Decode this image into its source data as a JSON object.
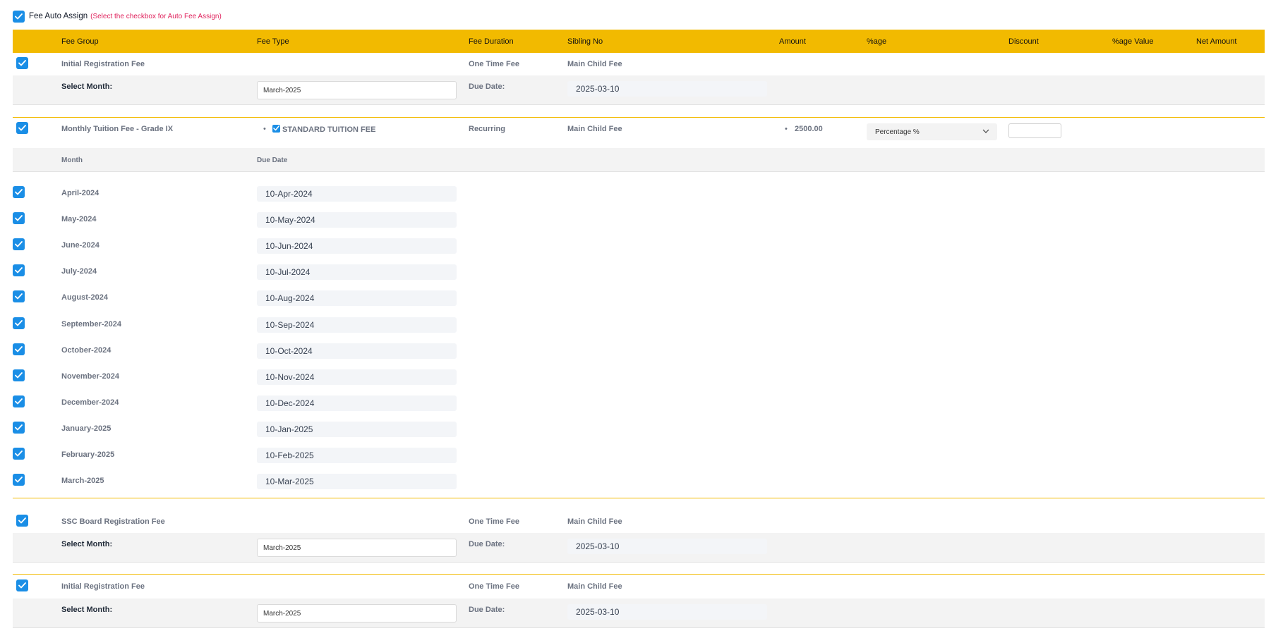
{
  "auto_assign": {
    "checked": true,
    "label": "Fee Auto Assign",
    "hint": "(Select the checkbox for Auto Fee Assign)"
  },
  "header": {
    "fee_group": "Fee Group",
    "fee_type": "Fee Type",
    "fee_duration": "Fee Duration",
    "sibling_no": "Sibling No",
    "amount": "Amount",
    "percentage": "%age",
    "discount": "Discount",
    "percentage_value": "%age Value",
    "net_amount": "Net Amount"
  },
  "common": {
    "select_month_label": "Select Month:",
    "due_date_label": "Due Date:",
    "month_col": "Month",
    "due_date_col": "Due Date"
  },
  "group1": {
    "name": "Initial Registration Fee",
    "duration": "One Time Fee",
    "sibling": "Main Child Fee",
    "month_value": "March-2025",
    "due_date_value": "2025-03-10"
  },
  "tuition": {
    "name": "Monthly Tuition Fee - Grade IX",
    "fee_type": "STANDARD TUITION FEE",
    "duration": "Recurring",
    "sibling": "Main Child Fee",
    "amount": "2500.00",
    "percentage_select": "Percentage %",
    "discount_value": "",
    "months": [
      {
        "month": "April-2024",
        "due": "10-Apr-2024"
      },
      {
        "month": "May-2024",
        "due": "10-May-2024"
      },
      {
        "month": "June-2024",
        "due": "10-Jun-2024"
      },
      {
        "month": "July-2024",
        "due": "10-Jul-2024"
      },
      {
        "month": "August-2024",
        "due": "10-Aug-2024"
      },
      {
        "month": "September-2024",
        "due": "10-Sep-2024"
      },
      {
        "month": "October-2024",
        "due": "10-Oct-2024"
      },
      {
        "month": "November-2024",
        "due": "10-Nov-2024"
      },
      {
        "month": "December-2024",
        "due": "10-Dec-2024"
      },
      {
        "month": "January-2025",
        "due": "10-Jan-2025"
      },
      {
        "month": "February-2025",
        "due": "10-Feb-2025"
      },
      {
        "month": "March-2025",
        "due": "10-Mar-2025"
      }
    ]
  },
  "group3": {
    "name": "SSC Board Registration Fee",
    "duration": "One Time Fee",
    "sibling": "Main Child Fee",
    "month_value": "March-2025",
    "due_date_value": "2025-03-10"
  },
  "group4": {
    "name": "Initial Registration Fee",
    "duration": "One Time Fee",
    "sibling": "Main Child Fee",
    "month_value": "March-2025",
    "due_date_value": "2025-03-10"
  },
  "colors": {
    "header_bg": "#f2ba00",
    "checkbox": "#1a8ee6",
    "hint": "#e0245e",
    "muted_text": "#6b7280"
  }
}
